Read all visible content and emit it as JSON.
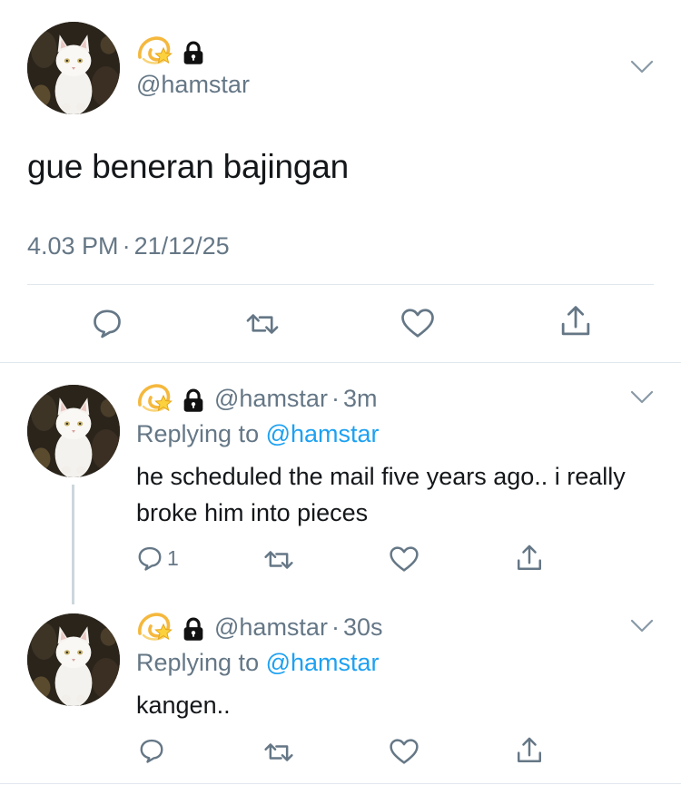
{
  "main_tweet": {
    "handle": "@hamstar",
    "text": "gue beneran bajingan",
    "time": "4.03 PM",
    "date": "21/12/25",
    "timestamp_sep": "·"
  },
  "replies": [
    {
      "handle": "@hamstar",
      "sep": "·",
      "age": "3m",
      "replying_prefix": "Replying to",
      "replying_handle": "@hamstar",
      "text": "he scheduled the mail five years ago.. i really broke him into pieces",
      "reply_count": "1"
    },
    {
      "handle": "@hamstar",
      "sep": "·",
      "age": "30s",
      "replying_prefix": "Replying to",
      "replying_handle": "@hamstar",
      "text": "kangen..",
      "reply_count": ""
    }
  ],
  "icons": {
    "name_emoji": "dizzy-star-emoji",
    "lock": "lock-icon",
    "more": "chevron-down-icon",
    "reply": "reply-icon",
    "retweet": "retweet-icon",
    "like": "heart-icon",
    "share": "share-icon"
  },
  "colors": {
    "text": "#14171a",
    "secondary": "#657786",
    "link": "#1da1f2",
    "divider": "#e1e8ed",
    "thread_line": "#ccd6dd"
  }
}
